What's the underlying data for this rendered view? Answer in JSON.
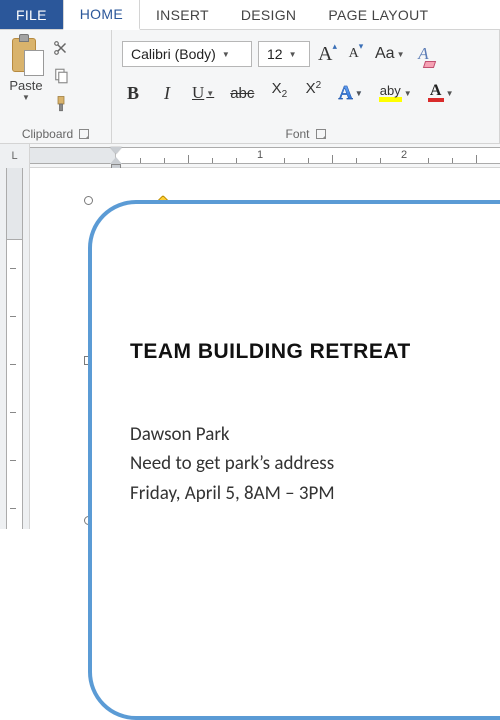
{
  "tabs": {
    "file": "FILE",
    "home": "HOME",
    "insert": "INSERT",
    "design": "DESIGN",
    "pagelayout": "PAGE LAYOUT"
  },
  "clipboard": {
    "paste_label": "Paste",
    "group_label": "Clipboard"
  },
  "font": {
    "name": "Calibri (Body)",
    "size": "12",
    "group_label": "Font",
    "change_case": "Aa",
    "highlight_label": "aby",
    "bold": "B",
    "italic": "I",
    "underline": "U",
    "strike": "abc",
    "sub_x": "X",
    "sub_2": "2",
    "sup_x": "X",
    "sup_2": "2",
    "effects_A": "A",
    "fontcolor_A": "A",
    "grow_A": "A",
    "shrink_A": "A",
    "clear_A": "A"
  },
  "ruler": {
    "corner": "L",
    "n1": "1",
    "n2": "2"
  },
  "document": {
    "title": "TEAM BUILDING RETREAT",
    "line1": "Dawson Park",
    "line2": "Need to get park’s address",
    "line3": "Friday, April 5, 8AM – 3PM"
  }
}
